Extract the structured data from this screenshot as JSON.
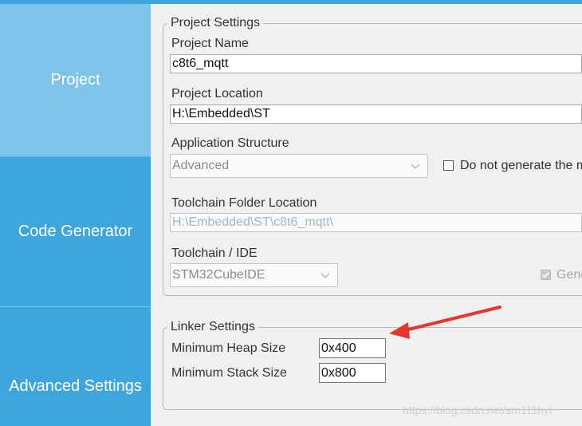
{
  "sidebar": {
    "items": [
      {
        "label": "Project"
      },
      {
        "label": "Code Generator"
      },
      {
        "label": "Advanced Settings"
      }
    ]
  },
  "project_settings": {
    "legend": "Project Settings",
    "project_name_label": "Project Name",
    "project_name_value": "c8t6_mqtt",
    "project_location_label": "Project Location",
    "project_location_value": "H:\\Embedded\\ST",
    "app_structure_label": "Application Structure",
    "app_structure_value": "Advanced",
    "do_not_generate_label": "Do not generate the m",
    "toolchain_folder_label": "Toolchain Folder Location",
    "toolchain_folder_value": "H:\\Embedded\\ST\\c8t6_mqtt\\",
    "toolchain_ide_label": "Toolchain / IDE",
    "toolchain_ide_value": "STM32CubeIDE",
    "generate_label": "Gene"
  },
  "linker_settings": {
    "legend": "Linker Settings",
    "min_heap_label": "Minimum Heap Size",
    "min_heap_value": "0x400",
    "min_stack_label": "Minimum Stack Size",
    "min_stack_value": "0x800"
  },
  "watermark": "https://blog.csdn.net/sm111hyi",
  "colors": {
    "sidebar_active": "#7dc4e8",
    "sidebar": "#3ea6dc",
    "annotation_arrow": "#e8362c"
  }
}
